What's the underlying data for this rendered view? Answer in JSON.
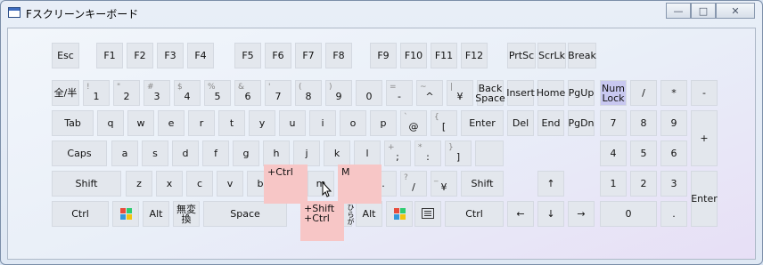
{
  "window": {
    "title": "Fスクリーンキーボード",
    "controls": {
      "minimize": "—",
      "maximize": "□",
      "close": "✕"
    }
  },
  "rows": {
    "fn": [
      "Esc",
      "F1",
      "F2",
      "F3",
      "F4",
      "F5",
      "F6",
      "F7",
      "F8",
      "F9",
      "F10",
      "F11",
      "F12",
      "PrtSc",
      "ScrLk",
      "Break"
    ],
    "num_main": "全/半",
    "num": [
      [
        "!",
        "1"
      ],
      [
        "\"",
        "2"
      ],
      [
        "#",
        "3"
      ],
      [
        "$",
        "4"
      ],
      [
        "%",
        "5"
      ],
      [
        "&",
        "6"
      ],
      [
        "'",
        "7"
      ],
      [
        "(",
        "8"
      ],
      [
        ")",
        "9"
      ],
      [
        "",
        "0"
      ],
      [
        "=",
        "-"
      ],
      [
        "~",
        "^"
      ],
      [
        "|",
        "¥"
      ]
    ],
    "backspace": [
      "Back",
      "Space"
    ],
    "nav1": [
      "Insert",
      "Home",
      "PgUp"
    ],
    "numlock": [
      "Num",
      "Lock"
    ],
    "np1": [
      "/",
      "*",
      "-"
    ],
    "tab": "Tab",
    "qrow": [
      "q",
      "w",
      "e",
      "r",
      "t",
      "y",
      "u",
      "i",
      "o",
      "p"
    ],
    "at": [
      "`",
      "@"
    ],
    "lbr": [
      "{",
      "["
    ],
    "enter": "Enter",
    "nav2": [
      "Del",
      "End",
      "PgDn"
    ],
    "np2": [
      "7",
      "8",
      "9"
    ],
    "plus": "+",
    "caps": "Caps",
    "arow": [
      "a",
      "s",
      "d",
      "f",
      "g",
      "h",
      "j",
      "k",
      "l"
    ],
    "semi": [
      "+",
      ";"
    ],
    "colon": [
      "*",
      ":"
    ],
    "rbr": [
      "}",
      "]"
    ],
    "np3": [
      "4",
      "5",
      "6"
    ],
    "shift": "Shift",
    "zrow": [
      "z",
      "x",
      "c",
      "v",
      "b"
    ],
    "m": "m",
    "period": ".",
    "slash": [
      "?",
      "/"
    ],
    "yen": [
      "_",
      "¥"
    ],
    "up": "↑",
    "np4": [
      "1",
      "2",
      "3"
    ],
    "np_enter": "Enter",
    "ctrl": "Ctrl",
    "alt": "Alt",
    "muhenkan": "無変換",
    "space": "Space",
    "kana": "ひらがな",
    "left": "←",
    "down": "↓",
    "right": "→",
    "np0": "0",
    "npdot": "."
  },
  "popups": {
    "ctrl_m": "+Ctrl",
    "upper_m": "M",
    "shift_ctrl": [
      "+Shift",
      "+Ctrl"
    ]
  },
  "colors": {
    "win_logo": [
      "#e74c3c",
      "#2ecc71",
      "#3498db",
      "#f1c40f"
    ],
    "popup_bg": "#f7c6c6"
  }
}
